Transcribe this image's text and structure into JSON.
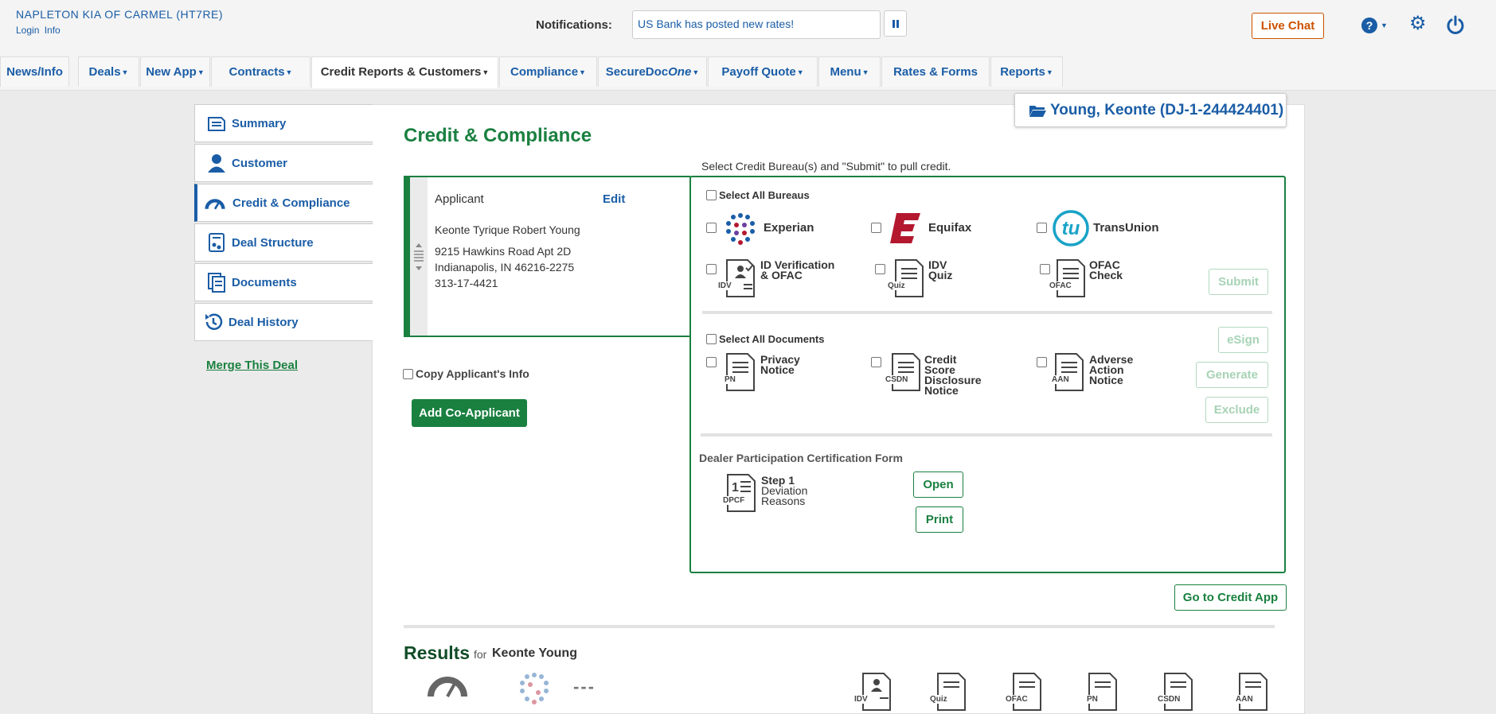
{
  "header": {
    "dealer_name": "NAPLETON KIA OF CARMEL (HT7RE)",
    "login_label": "Login",
    "info_label": "Info",
    "notifications_label": "Notifications:",
    "notification_text": "US Bank has posted new rates!",
    "live_chat_label": "Live Chat",
    "help_icon_text": "?"
  },
  "nav": {
    "tabs": [
      {
        "label": "News/Info",
        "caret": false
      },
      {
        "label": "Deals",
        "caret": true
      },
      {
        "label": "New App",
        "caret": true
      },
      {
        "label": "Contracts",
        "caret": true
      },
      {
        "label": "Credit Reports & Customers",
        "caret": true,
        "active": true
      },
      {
        "label": "Compliance",
        "caret": true
      },
      {
        "label_prefix": "SecureDoc",
        "label_suffix": "One",
        "caret": true
      },
      {
        "label": "Payoff Quote",
        "caret": true
      },
      {
        "label": "Menu",
        "caret": true
      },
      {
        "label": "Rates & Forms",
        "caret": false
      },
      {
        "label": "Reports",
        "caret": true
      }
    ]
  },
  "sidebar": {
    "items": [
      {
        "label": "Summary",
        "icon": "summary-icon"
      },
      {
        "label": "Customer",
        "icon": "customer-icon"
      },
      {
        "label": "Credit & Compliance",
        "icon": "gauge-icon",
        "active": true
      },
      {
        "label": "Deal Structure",
        "icon": "deal-structure-icon"
      },
      {
        "label": "Documents",
        "icon": "documents-icon"
      },
      {
        "label": "Deal History",
        "icon": "history-icon"
      }
    ],
    "merge_link": "Merge This Deal"
  },
  "deal_badge": "Young, Keonte (DJ-1-244424401)",
  "page_title": "Credit & Compliance",
  "applicant": {
    "label": "Applicant",
    "edit": "Edit",
    "name": "Keonte Tyrique Robert Young",
    "address1": "9215 Hawkins Road Apt 2D",
    "address2": "Indianapolis, IN 46216-2275",
    "ssn": "313-17-4421"
  },
  "copy_applicant_label": "Copy Applicant's Info",
  "add_coapplicant_label": "Add Co-Applicant",
  "bureau": {
    "hint": "Select Credit Bureau(s) and \"Submit\" to pull credit.",
    "select_all": "Select All Bureaus",
    "experian": "Experian",
    "equifax": "Equifax",
    "transunion": "TransUnion",
    "idv_ofac_1": "ID Verification",
    "idv_ofac_2": "& OFAC",
    "idv_quiz_1": "IDV",
    "idv_quiz_2": "Quiz",
    "ofac_1": "OFAC",
    "ofac_2": "Check",
    "submit": "Submit",
    "icon_idv": "IDV",
    "icon_quiz": "Quiz",
    "icon_ofac": "OFAC"
  },
  "documents": {
    "select_all": "Select All Documents",
    "pn_1": "Privacy",
    "pn_2": "Notice",
    "csdn_1": "Credit",
    "csdn_2": "Score",
    "csdn_3": "Disclosure",
    "csdn_4": "Notice",
    "aan_1": "Adverse",
    "aan_2": "Action",
    "aan_3": "Notice",
    "esign": "eSign",
    "generate": "Generate",
    "exclude": "Exclude",
    "icon_pn": "PN",
    "icon_csdn": "CSDN",
    "icon_aan": "AAN"
  },
  "dpcf": {
    "title": "Dealer Participation Certification Form",
    "step": "Step 1",
    "desc_1": "Deviation",
    "desc_2": "Reasons",
    "icon_text": "DPCF",
    "open": "Open",
    "print": "Print"
  },
  "go_credit_app": "Go to Credit App",
  "results": {
    "title": "Results",
    "for": "for",
    "name": "Keonte Young",
    "score_placeholder": "---",
    "icons": [
      "IDV",
      "Quiz",
      "OFAC",
      "PN",
      "CSDN",
      "AAN"
    ]
  },
  "colors": {
    "brand_blue": "#1a5da6",
    "brand_green": "#1a8040",
    "live_chat_orange": "#cc5200",
    "equifax_red": "#b3182f",
    "transunion_teal": "#1aa3c8"
  }
}
